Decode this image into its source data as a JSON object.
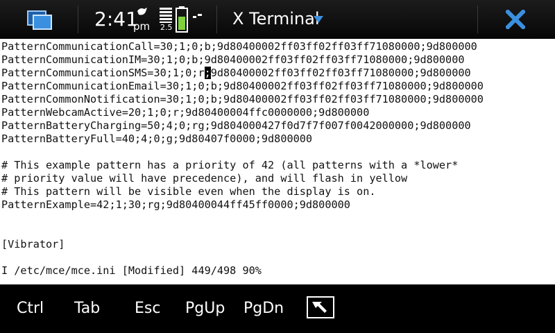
{
  "statusbar": {
    "time": "2:41",
    "ampm": "pm",
    "network_label": "2.5",
    "colors": {
      "accent": "#3b8fe0",
      "battery": "#7fd23b",
      "close": "#3b8fe0"
    }
  },
  "header": {
    "title": "X Terminal",
    "menu_icon": "chevron-down-icon",
    "close_icon": "close-icon"
  },
  "terminal": {
    "lines": [
      "PatternCommunicationCall=30;1;0;b;9d80400002ff03ff02ff03ff71080000;9d800000",
      "PatternCommunicationIM=30;1;0;b;9d80400002ff03ff02ff03ff71080000;9d800000",
      "PatternCommunicationSMS=30;1;0;r;9d80400002ff03ff02ff03ff71080000;9d800000",
      "PatternCommunicationEmail=30;1;0;b;9d80400002ff03ff02ff03ff71080000;9d800000",
      "PatternCommonNotification=30;1;0;b;9d80400002ff03ff02ff03ff71080000;9d800000",
      "PatternWebcamActive=20;1;0;r;9d80400004ffc0000000;9d800000",
      "PatternBatteryCharging=50;4;0;rg;9d804000427f0d7f7f007f0042000000;9d800000",
      "PatternBatteryFull=40;4;0;g;9d80407f0000;9d800000",
      "",
      "# This example pattern has a priority of 42 (all patterns with a *lower*",
      "# priority value will have precedence), and will flash in yellow",
      "# This pattern will be visible even when the display is on.",
      "PatternExample=42;1;30;rg;9d80400044ff45ff0000;9d800000",
      "",
      "",
      "[Vibrator]",
      "",
      "I /etc/mce/mce.ini [Modified] 449/498 90%"
    ],
    "cursor": {
      "line": 2,
      "before": "PatternCommunicationSMS=30;1;0;r",
      "char": ";",
      "after": "9d80400002ff03ff02ff03ff71080000;9d800000"
    }
  },
  "toolbar": {
    "buttons": [
      {
        "label": "Ctrl"
      },
      {
        "label": "Tab"
      },
      {
        "label": "Esc"
      },
      {
        "label": "PgUp"
      },
      {
        "label": "PgDn"
      }
    ],
    "keyboard_toggle_icon": "keyboard-toggle-icon"
  }
}
